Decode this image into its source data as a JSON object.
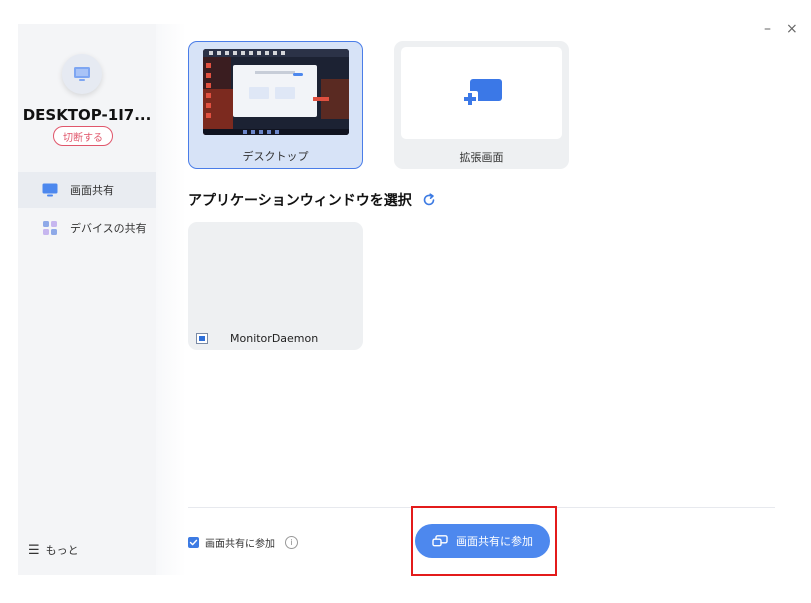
{
  "window": {
    "minimize_label": "–",
    "close_label": "×"
  },
  "sidebar": {
    "avatar_icon": "monitor-icon",
    "device_name": "DESKTOP-1I7...",
    "disconnect_label": "切断する",
    "items": [
      {
        "label": "画面共有",
        "icon": "monitor-icon",
        "active": true
      },
      {
        "label": "デバイスの共有",
        "icon": "devices-grid-icon",
        "active": false
      }
    ],
    "more_label": "もっと"
  },
  "screens": [
    {
      "label": "デスクトップ",
      "selected": true
    },
    {
      "label": "拡張画面",
      "selected": false
    }
  ],
  "apps": {
    "title": "アプリケーションウィンドウを選択",
    "items": [
      {
        "label": "MonitorDaemon"
      }
    ]
  },
  "footer": {
    "checkbox_label": "画面共有に参加",
    "checked": true,
    "join_button_label": "画面共有に参加"
  },
  "colors": {
    "accent": "#4d88ee",
    "disconnect": "#e0566b",
    "highlight": "#e31b1b"
  }
}
